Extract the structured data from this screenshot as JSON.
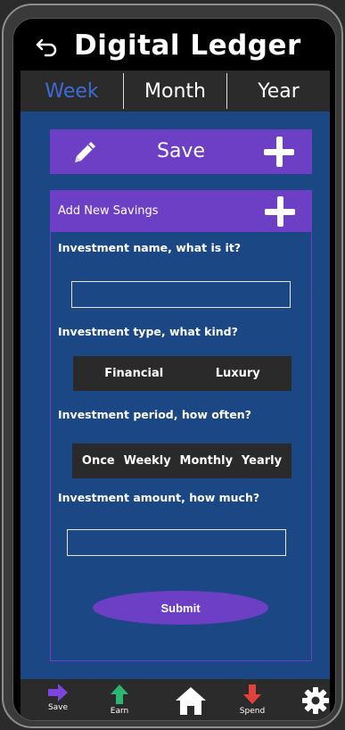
{
  "header": {
    "title": "Digital Ledger"
  },
  "tabs": [
    {
      "label": "Week",
      "active": true
    },
    {
      "label": "Month",
      "active": false
    },
    {
      "label": "Year",
      "active": false
    }
  ],
  "save_bar": {
    "label": "Save"
  },
  "form": {
    "heading": "Add New Savings",
    "name_question": "Investment name, what is it?",
    "name_value": "",
    "type_question": "Investment type, what kind?",
    "type_options": [
      "Financial",
      "Luxury"
    ],
    "period_question": "Investment period, how often?",
    "period_options": [
      "Once",
      "Weekly",
      "Monthly",
      "Yearly"
    ],
    "amount_question": "Investment amount, how much?",
    "amount_value": "",
    "submit_label": "Submit"
  },
  "bottom_nav": [
    {
      "label": "Save",
      "icon": "right-arrow-icon",
      "color": "#6c3fc4"
    },
    {
      "label": "Earn",
      "icon": "up-arrow-icon",
      "color": "#2bb673"
    },
    {
      "label": "",
      "icon": "home-icon",
      "color": "#ffffff"
    },
    {
      "label": "Spend",
      "icon": "down-arrow-icon",
      "color": "#e0413a"
    },
    {
      "label": "",
      "icon": "gear-icon",
      "color": "#ffffff"
    }
  ],
  "colors": {
    "accent": "#6c3fc4",
    "main_bg": "#1b4785",
    "active_tab": "#3d6bd6"
  }
}
